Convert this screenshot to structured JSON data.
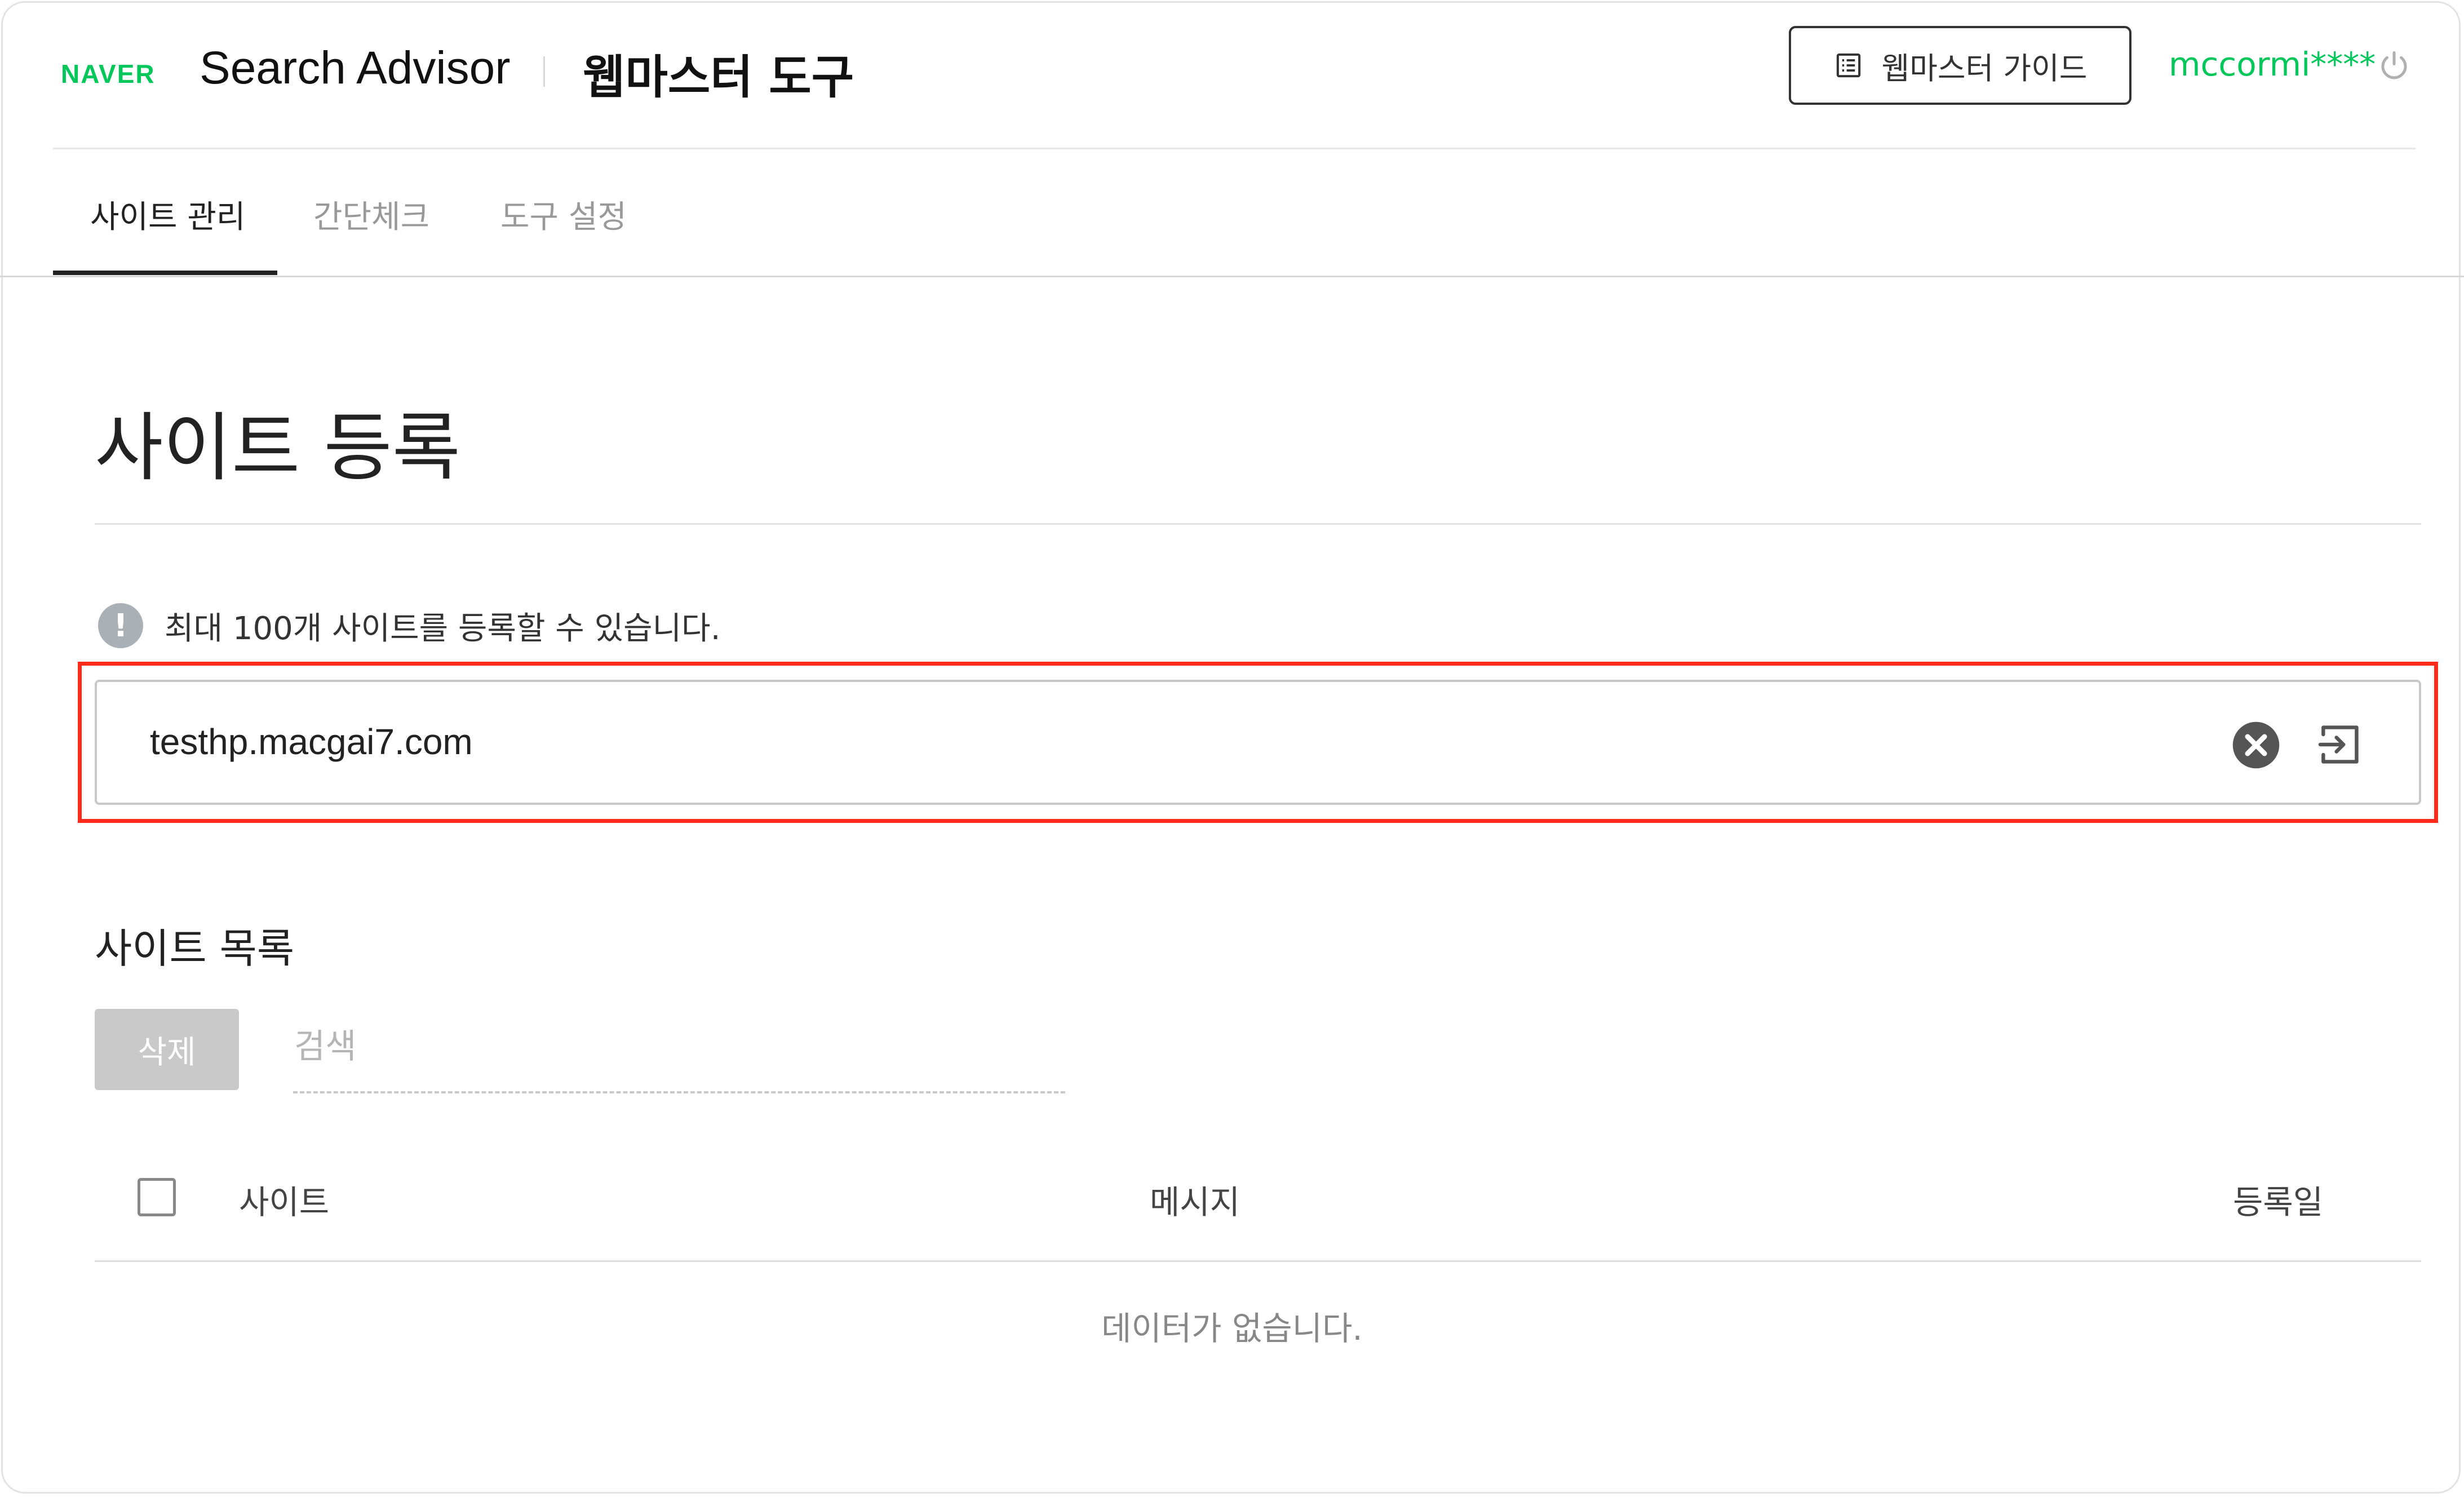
{
  "header": {
    "naver_logo": "NAVER",
    "brand": "Search Advisor",
    "app_title": "웹마스터 도구",
    "guide_button": "웹마스터 가이드",
    "user_id": "mccormi****"
  },
  "tabs": [
    {
      "label": "사이트 관리",
      "active": true
    },
    {
      "label": "간단체크",
      "active": false
    },
    {
      "label": "도구 설정",
      "active": false
    }
  ],
  "page": {
    "title": "사이트 등록",
    "notice": "최대 100개 사이트를 등록할 수 있습니다.",
    "site_input_value": "testhp.macgai7.com"
  },
  "site_list": {
    "title": "사이트 목록",
    "delete_button": "삭제",
    "search_placeholder": "검색",
    "columns": [
      "사이트",
      "메시지",
      "등록일"
    ],
    "empty_message": "데이터가 없습니다."
  },
  "colors": {
    "accent_green": "#03c75a",
    "highlight_red": "#ff2a1a"
  },
  "icons": [
    "list-doc-icon",
    "power-icon",
    "info-icon",
    "clear-icon",
    "submit-arrow-icon",
    "checkbox"
  ]
}
